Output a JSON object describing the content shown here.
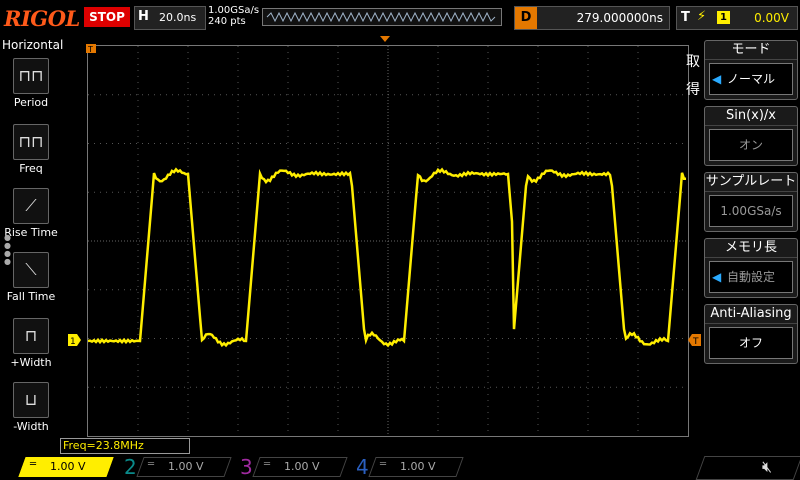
{
  "top": {
    "brand": "RIGOL",
    "run_state": "STOP",
    "timebase_key": "H",
    "timebase_value": "20.0ns",
    "sample_rate": "1.00GSa/s",
    "memory_depth": "240 pts",
    "delay_key": "D",
    "delay_value": "279.000000ns",
    "trigger_key": "T",
    "trigger_channel": "1",
    "trigger_level": "0.00V"
  },
  "horizontal": {
    "title": "Horizontal",
    "items": [
      {
        "label": "Period",
        "icon": "period-icon",
        "glyph": "⊓⊓"
      },
      {
        "label": "Freq",
        "icon": "freq-icon",
        "glyph": "⊓⊓"
      },
      {
        "label": "Rise Time",
        "icon": "rise-time-icon",
        "glyph": "⟋"
      },
      {
        "label": "Fall Time",
        "icon": "fall-time-icon",
        "glyph": "⟍"
      },
      {
        "label": "+Width",
        "icon": "positive-width-icon",
        "glyph": "⊓"
      },
      {
        "label": "-Width",
        "icon": "negative-width-icon",
        "glyph": "⊔"
      }
    ]
  },
  "menu": {
    "side_label": "取得",
    "mode_title": "モード",
    "mode_value": "ノーマル",
    "sinx_title": "Sin(x)/x",
    "sinx_value": "オン",
    "samplerate_title": "サンプルレート",
    "samplerate_value": "1.00GSa/s",
    "memdepth_title": "メモリ長",
    "memdepth_value": "自動設定",
    "antialias_title": "Anti-Aliasing",
    "antialias_value": "オフ"
  },
  "freq_readout": "Freq=23.8MHz",
  "channels": [
    {
      "num": "1",
      "volts": "1.00 V",
      "color": "#ffee00",
      "active": true
    },
    {
      "num": "2",
      "volts": "1.00 V",
      "color": "#00c8c8",
      "active": false
    },
    {
      "num": "3",
      "volts": "1.00 V",
      "color": "#e040e0",
      "active": false
    },
    {
      "num": "4",
      "volts": "1.00 V",
      "color": "#2a7fff",
      "active": false
    }
  ],
  "colors": {
    "ch1": "#ffee00",
    "accent": "#e47800",
    "stop": "#dd0000"
  },
  "waveform": {
    "type": "square",
    "frequency_readout": "23.8MHz",
    "channel": "1"
  }
}
